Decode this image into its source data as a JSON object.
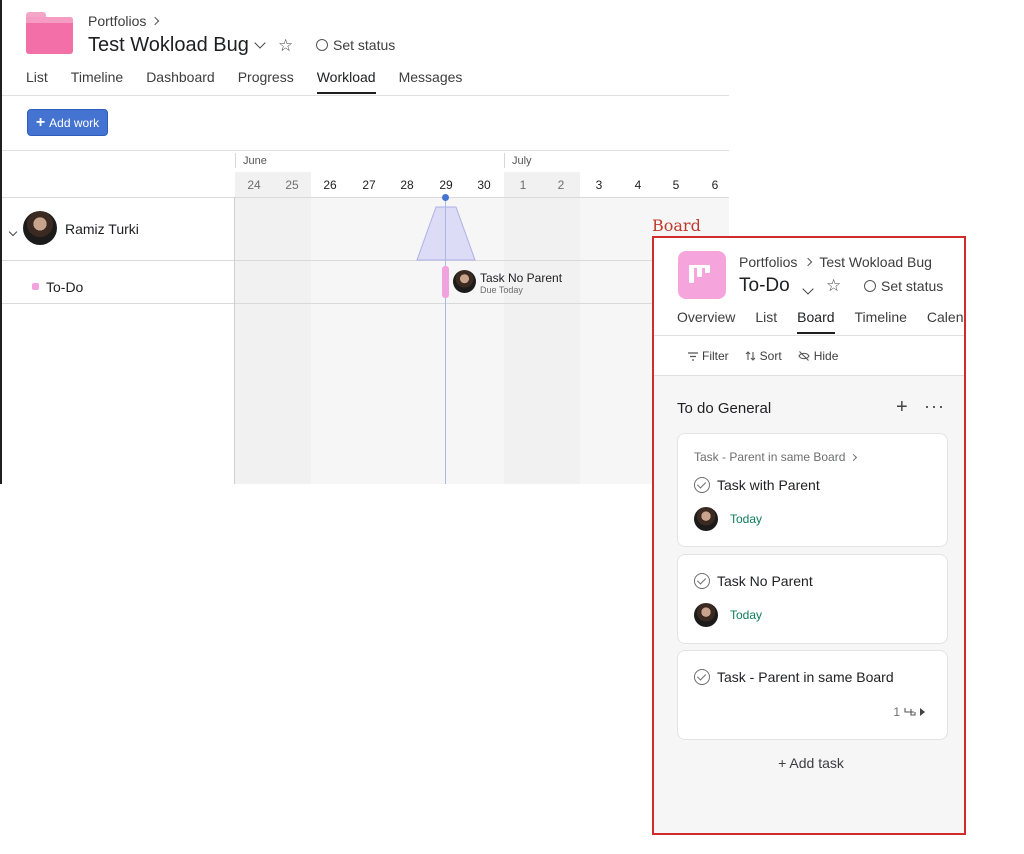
{
  "workload": {
    "breadcrumb": "Portfolios",
    "title": "Test Wokload Bug",
    "set_status": "Set status",
    "tabs": [
      "List",
      "Timeline",
      "Dashboard",
      "Progress",
      "Workload",
      "Messages"
    ],
    "active_tab": "Workload",
    "add_work_label": "Add work",
    "months": [
      "June",
      "July"
    ],
    "days": [
      "24",
      "25",
      "26",
      "27",
      "28",
      "29",
      "30",
      "1",
      "2",
      "3",
      "4",
      "5",
      "6"
    ],
    "user_name": "Ramiz Turki",
    "project_row": "To-Do",
    "task_name": "Task No Parent",
    "task_due": "Due Today"
  },
  "board_label": "Board",
  "board": {
    "breadcrumb_parent": "Portfolios",
    "breadcrumb_project": "Test Wokload Bug",
    "title": "To-Do",
    "set_status": "Set status",
    "tabs": [
      "Overview",
      "List",
      "Board",
      "Timeline",
      "Calendar"
    ],
    "active_tab": "Board",
    "tools": {
      "filter": "Filter",
      "sort": "Sort",
      "hide": "Hide"
    },
    "column_title": "To do General",
    "cards": [
      {
        "parent": "Task - Parent in same Board",
        "name": "Task with Parent",
        "due": "Today"
      },
      {
        "name": "Task No Parent",
        "due": "Today"
      },
      {
        "name": "Task - Parent in same Board",
        "subtasks": "1"
      }
    ],
    "add_task_label": "Add task"
  },
  "colors": {
    "accent_blue": "#4573d2",
    "project_pink": "#f1a3e0",
    "due_green": "#0d7f58",
    "highlight_red": "#d22b2b"
  }
}
